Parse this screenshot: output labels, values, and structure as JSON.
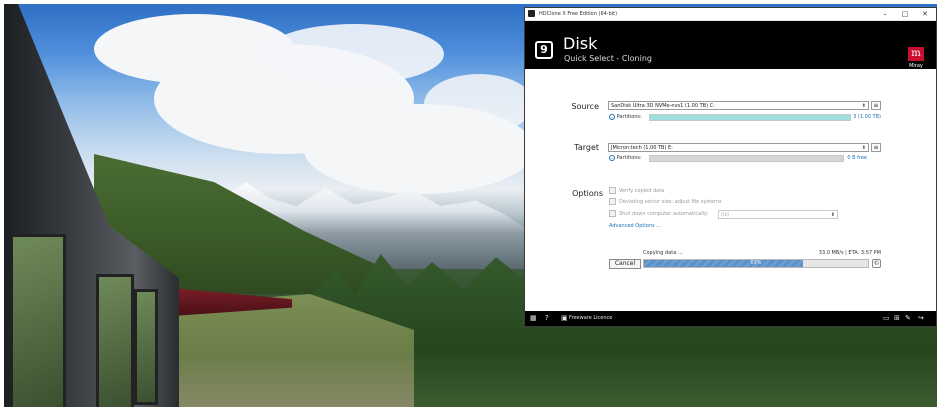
{
  "window": {
    "title": "HDClone X Free Edition (64-bit)",
    "minimize": "–",
    "maximize": "□",
    "close": "✕"
  },
  "header": {
    "title": "Disk",
    "subtitle": "Quick Select - Cloning",
    "icon": "disk-icon",
    "brand_mark": "m",
    "brand_name": "Miray"
  },
  "source": {
    "label": "Source",
    "selected": "SanDisk Ultra 3D NVMe-nvs1   (1.00 TB)   C:",
    "partitions_label": "Partitions:",
    "partitions_info": "3 (1.00 TB)",
    "fill_percent": 100,
    "fill_color": "#9fe0dc"
  },
  "target": {
    "label": "Target",
    "selected": "JMicron:tech   (1.00 TB)   E:",
    "partitions_label": "Partitions:",
    "partitions_info": "0 B free",
    "fill_percent": 100,
    "fill_color": "#d5d5d5"
  },
  "options": {
    "label": "Options",
    "verify": "Verify copied data",
    "deviating": "Deviating sector size: adjust file systems",
    "shutdown": "Shut down computer automatically:",
    "shutdown_value": "(ls)",
    "advanced": "Advanced Options ..."
  },
  "progress": {
    "status": "Copying data ...",
    "rate": "33.0 MB/s | ETA: 3:57 PM",
    "percent": 0,
    "percent_fill": 0.71,
    "percent_text": "69%",
    "cancel": "Cancel",
    "info_icon": "©"
  },
  "footer": {
    "licence": "Freeware Licence"
  },
  "colors": {
    "accent": "#1e6fb8",
    "brand": "#c8102e",
    "header_bg": "#000000"
  }
}
